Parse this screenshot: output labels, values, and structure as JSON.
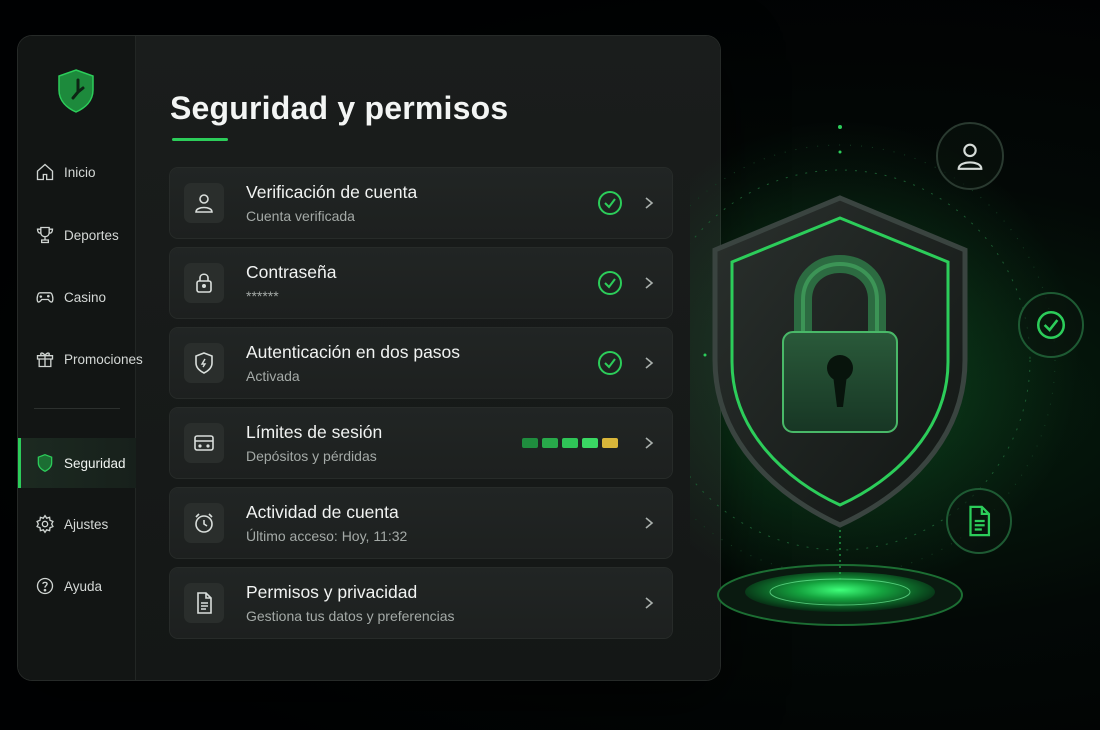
{
  "title": "Seguridad y permisos",
  "nav": {
    "items": [
      {
        "label": "Inicio",
        "icon": "home-icon"
      },
      {
        "label": "Deportes",
        "icon": "trophy-icon"
      },
      {
        "label": "Casino",
        "icon": "gamepad-icon"
      },
      {
        "label": "Promociones",
        "icon": "gift-icon"
      },
      {
        "label": "Seguridad",
        "icon": "shield-icon",
        "active": true
      },
      {
        "label": "Ajustes",
        "icon": "gear-icon"
      },
      {
        "label": "Ayuda",
        "icon": "help-icon"
      }
    ]
  },
  "rows": [
    {
      "title": "Verificación de cuenta",
      "subtitle": "Cuenta verificada",
      "icon": "user-icon",
      "status": "check"
    },
    {
      "title": "Contraseña",
      "subtitle": "******",
      "icon": "lock-icon",
      "status": "check"
    },
    {
      "title": "Autenticación en dos pasos",
      "subtitle": "Activada",
      "icon": "shield-icon",
      "status": "check"
    },
    {
      "title": "Límites de sesión",
      "subtitle": "Depósitos y pérdidas",
      "icon": "card-icon",
      "status": "meter",
      "meter_level": 5
    },
    {
      "title": "Actividad de cuenta",
      "subtitle": "Último acceso: Hoy, 11:32",
      "icon": "clock-icon",
      "status": "none"
    },
    {
      "title": "Permisos y privacidad",
      "subtitle": "Gestiona tus datos y preferencias",
      "icon": "document-icon",
      "status": "none"
    }
  ],
  "colors": {
    "accent": "#2ccd5a",
    "meter": [
      "#1f8c3e",
      "#28a94a",
      "#2fc457",
      "#3ad863",
      "#d9b63a"
    ]
  }
}
